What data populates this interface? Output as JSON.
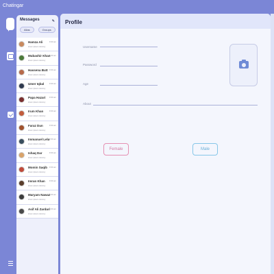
{
  "app": {
    "title": "Chatingar"
  },
  "rail": {
    "icons": [
      "chat-icon",
      "profile-icon",
      "settings-icon",
      "menu-icon"
    ]
  },
  "messages": {
    "title": "Messages",
    "edit_icon": "pencil-icon",
    "filters": [
      "Alias",
      "Groups"
    ],
    "contacts": [
      {
        "name": "Hamza Ali",
        "message": "lorem Ipsum dummy",
        "time": "9:30 am",
        "avatar_color": "#c98a5e"
      },
      {
        "name": "Mubashir Khan",
        "message": "lorem Ipsum dummy",
        "time": "9:30 am",
        "avatar_color": "#4b7a3a"
      },
      {
        "name": "Hassena Butt",
        "message": "lorem Ipsum dummy",
        "time": "9:30 am",
        "avatar_color": "#b76a4a"
      },
      {
        "name": "Umer Iqbal",
        "message": "lorem Ipsum dummy",
        "time": "9:30 am",
        "avatar_color": "#2f3a4f"
      },
      {
        "name": "Papa Hazari",
        "message": "lorem Ipsum dummy",
        "time": "9:30 am",
        "avatar_color": "#7a2f2f"
      },
      {
        "name": "Irum Khan",
        "message": "lorem Ipsum dummy",
        "time": "9:30 am",
        "avatar_color": "#c25c3c"
      },
      {
        "name": "Faraz Dun",
        "message": "lorem Ipsum dummy",
        "time": "9:30 am",
        "avatar_color": "#a0522d"
      },
      {
        "name": "Immanuel Lela",
        "message": "lorem Ipsum dummy",
        "time": "9:30 am",
        "avatar_color": "#3a4e5e"
      },
      {
        "name": "Ishaq Dar",
        "message": "lorem Ipsum dummy",
        "time": "9:30 am",
        "avatar_color": "#d9a36a"
      },
      {
        "name": "Momin Saqib",
        "message": "lorem Ipsum dummy",
        "time": "9:30 am",
        "avatar_color": "#c04a3a"
      },
      {
        "name": "Imran Khan",
        "message": "lorem Ipsum dummy",
        "time": "9:30 am",
        "avatar_color": "#5a3d2b"
      },
      {
        "name": "Maryam Nawaz",
        "message": "lorem Ipsum dummy",
        "time": "9:30 am",
        "avatar_color": "#3c3c3c"
      },
      {
        "name": "Asif Ali Zardari",
        "message": "lorem Ipsum dummy",
        "time": "9:30 am",
        "avatar_color": "#4a4a4a"
      }
    ]
  },
  "profile": {
    "title": "Profile",
    "fields": {
      "username": "Username",
      "password": "Password",
      "age": "Age",
      "about": "About"
    },
    "photo_icon": "camera-icon",
    "gender": {
      "female": "Female",
      "male": "Male"
    }
  },
  "colors": {
    "accent": "#7b86d6",
    "female": "#e58fb2",
    "male": "#86c6e8"
  }
}
